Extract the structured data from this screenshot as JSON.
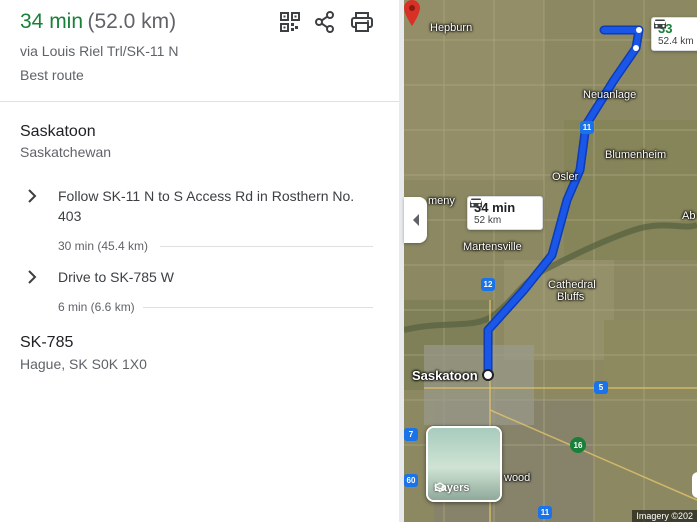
{
  "route": {
    "duration": "34 min",
    "distance": "(52.0 km)",
    "via": "via Louis Riel Trl/SK-11 N",
    "best": "Best route"
  },
  "toolbar": {
    "qr_icon": "qr-code-icon",
    "share_icon": "share-icon",
    "print_icon": "print-icon"
  },
  "start": {
    "name": "Saskatoon",
    "region": "Saskatchewan"
  },
  "steps": [
    {
      "text": "Follow SK-11 N to S Access Rd in Rosthern No. 403",
      "meta": "30 min (45.4 km)"
    },
    {
      "text": "Drive to SK-785 W",
      "meta": "6 min (6.6 km)"
    }
  ],
  "end": {
    "name": "SK-785",
    "address": "Hague, SK S0K 1X0"
  },
  "map": {
    "labels": {
      "hepburn": "Hepburn",
      "neuanlage": "Neuanlage",
      "blumenheim": "Blumenheim",
      "osler": "Osler",
      "meny": "meny",
      "abr": "Ab",
      "martensville": "Martensville",
      "cathedral": "Cathedral",
      "bluffs": "Bluffs",
      "saskatoon": "Saskatoon",
      "wood": "wood"
    },
    "shields": {
      "s11a": "11",
      "s12": "12",
      "s5": "5",
      "s16": "16",
      "s11b": "11",
      "s7": "7",
      "s60": "60"
    },
    "callout_main": {
      "time": "34 min",
      "dist": "52 km"
    },
    "callout_alt": {
      "time": "33",
      "dist": "52.4 km"
    },
    "layers": "Layers",
    "imagery": "Imagery ©202",
    "route_color": "#1a56e8"
  }
}
